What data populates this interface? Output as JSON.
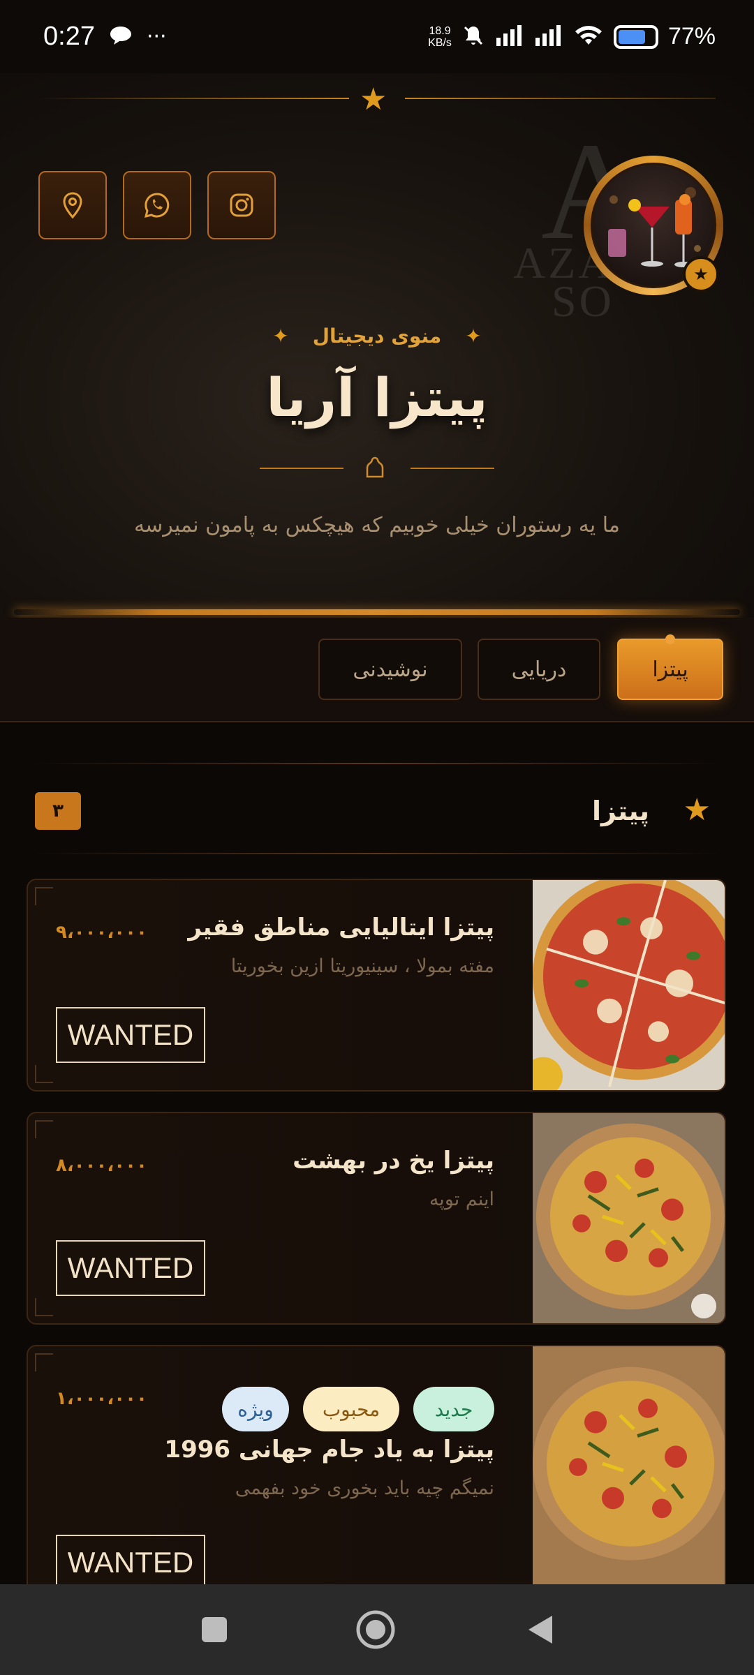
{
  "status_bar": {
    "time": "0:27",
    "more": "···",
    "speed_value": "18.9",
    "speed_unit": "KB/s",
    "battery_pct": "77%",
    "battery_level": 0.77
  },
  "header": {
    "watermark_letter": "A",
    "watermark_text_1": "AZA",
    "watermark_text_2": "SO",
    "subtitle": "منوی دیجیتال",
    "title": "پیتزا آریا",
    "tagline": "ما یه رستوران خیلی خوبیم که هیچکس به پامون نمیرسه",
    "social_icons": [
      "location-icon",
      "whatsapp-icon",
      "instagram-icon"
    ],
    "accent_color": "#e09a1e"
  },
  "tabs": [
    {
      "label": "پیتزا",
      "active": true
    },
    {
      "label": "دریایی",
      "active": false
    },
    {
      "label": "نوشیدنی",
      "active": false
    }
  ],
  "section": {
    "title": "پیتزا",
    "count": "۳"
  },
  "items": [
    {
      "name": "پیتزا ایتالیایی مناطق فقیر",
      "desc": "مفته بمولا ، سینیوریتا ازین بخوریتا",
      "price": "۹،۰۰۰،۰۰۰",
      "action": "WANTED",
      "badges": []
    },
    {
      "name": "پیتزا یخ در بهشت",
      "desc": "اینم توپه",
      "price": "۸،۰۰۰،۰۰۰",
      "action": "WANTED",
      "badges": []
    },
    {
      "name": "پیتزا به یاد جام جهانی 1996",
      "desc": "نمیگم چیه باید بخوری خود بفهمی",
      "price": "۱،۰۰۰،۰۰۰",
      "action": "WANTED",
      "badges": [
        {
          "label": "جدید",
          "bg": "#c8f0dc",
          "fg": "#1f7a4e"
        },
        {
          "label": "محبوب",
          "bg": "#fbecc2",
          "fg": "#8a5a12"
        },
        {
          "label": "ویژه",
          "bg": "#dceaf8",
          "fg": "#2d5f94"
        }
      ]
    }
  ]
}
